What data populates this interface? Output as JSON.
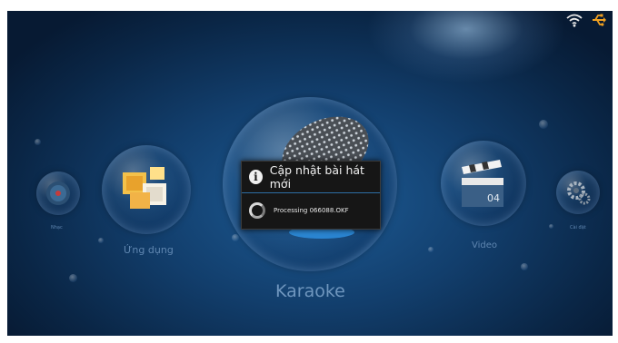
{
  "status_bar": {
    "wifi_icon": "wifi-icon",
    "usb_icon": "usb-icon",
    "usb_color": "#f0a020"
  },
  "menu": {
    "items": [
      {
        "label": "Nhạc",
        "icon": "music-disc-icon"
      },
      {
        "label": "Ứng dụng",
        "icon": "apps-box-icon"
      },
      {
        "label": "Karaoke",
        "icon": "microphone-icon"
      },
      {
        "label": "Video",
        "icon": "clapperboard-icon"
      },
      {
        "label": "Cài đặt",
        "icon": "gear-icon"
      }
    ]
  },
  "dialog": {
    "title": "Cập nhật bài hát mới",
    "message": "Processing  066088.OKF",
    "icon": "info-icon"
  },
  "colors": {
    "accent": "#2d6ea5",
    "background": "#123e6c"
  }
}
